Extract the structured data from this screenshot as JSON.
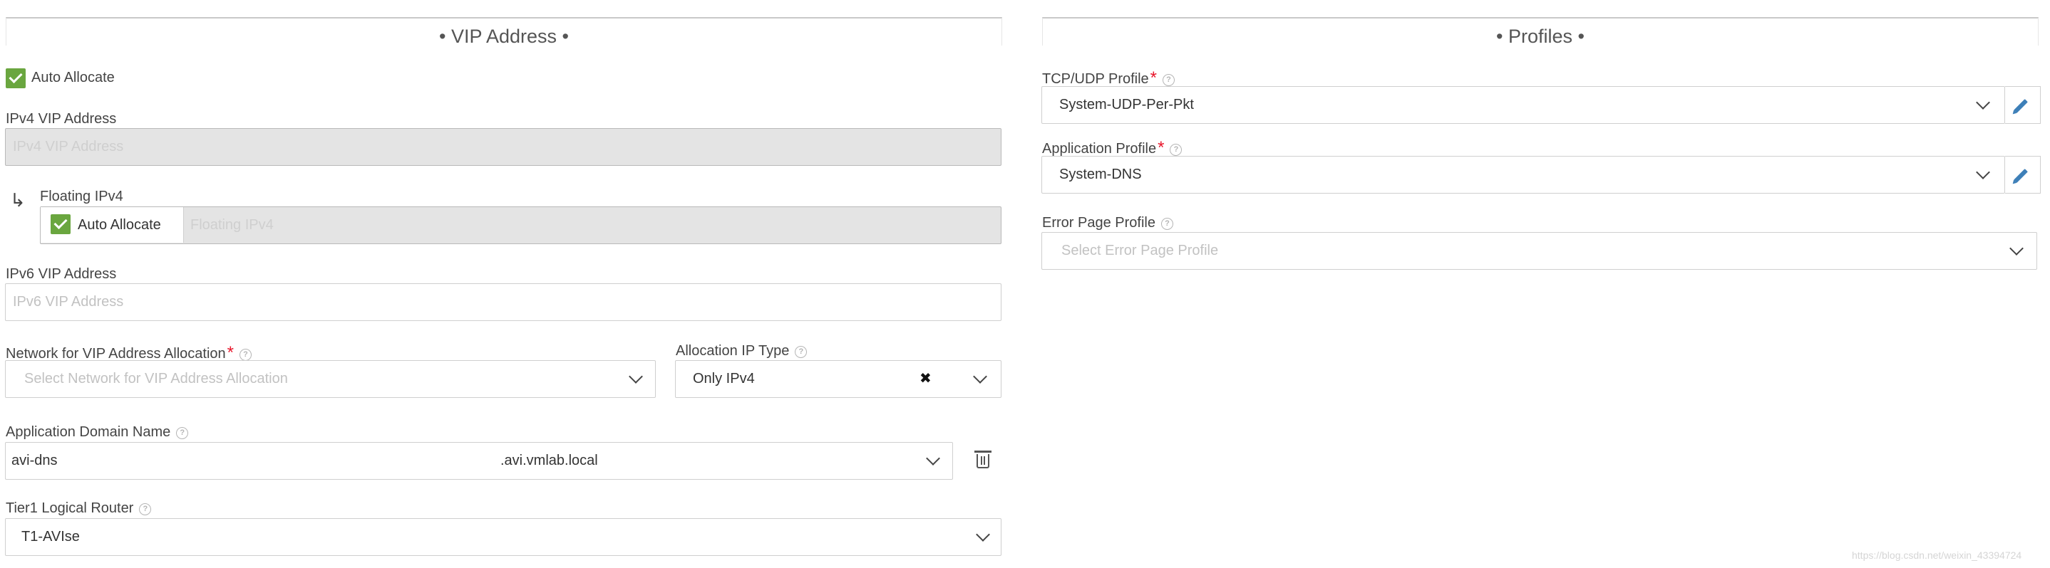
{
  "vip_section": {
    "title": "• VIP Address •",
    "auto_allocate_label": "Auto Allocate",
    "ipv4_label": "IPv4 VIP Address",
    "ipv4_placeholder": "IPv4 VIP Address",
    "floating_label": "Floating IPv4",
    "floating_auto_allocate_label": "Auto Allocate",
    "floating_placeholder": "Floating IPv4",
    "ipv6_label": "IPv6 VIP Address",
    "ipv6_placeholder": "IPv6 VIP Address",
    "network_label": "Network for VIP Address Allocation",
    "network_placeholder": "Select Network for VIP Address Allocation",
    "alloc_type_label": "Allocation IP Type",
    "alloc_type_value": "Only IPv4",
    "domain_label": "Application Domain Name",
    "domain_value": "avi-dns",
    "domain_suffix": ".avi.vmlab.local",
    "tier1_label": "Tier1 Logical Router",
    "tier1_value": "T1-AVIse"
  },
  "profiles_section": {
    "title": "• Profiles •",
    "tcp_udp_label": "TCP/UDP Profile",
    "tcp_udp_value": "System-UDP-Per-Pkt",
    "app_profile_label": "Application Profile",
    "app_profile_value": "System-DNS",
    "error_page_label": "Error Page Profile",
    "error_page_placeholder": "Select Error Page Profile"
  },
  "required_marker": "*",
  "help_glyph": "?",
  "icons": {
    "checkbox": "checkbox-checked-icon",
    "dropdown": "chevron-down-icon",
    "edit": "pencil-icon",
    "clear": "close-icon",
    "delete": "trash-icon",
    "floating_arrow": "arrow-down-right-icon"
  },
  "colors": {
    "checkbox_green": "#6aa63f",
    "required_red": "#e8152a",
    "edit_blue": "#3d7fb8",
    "disabled_bg": "#e4e4e4"
  },
  "watermark": "https://blog.csdn.net/weixin_43394724"
}
